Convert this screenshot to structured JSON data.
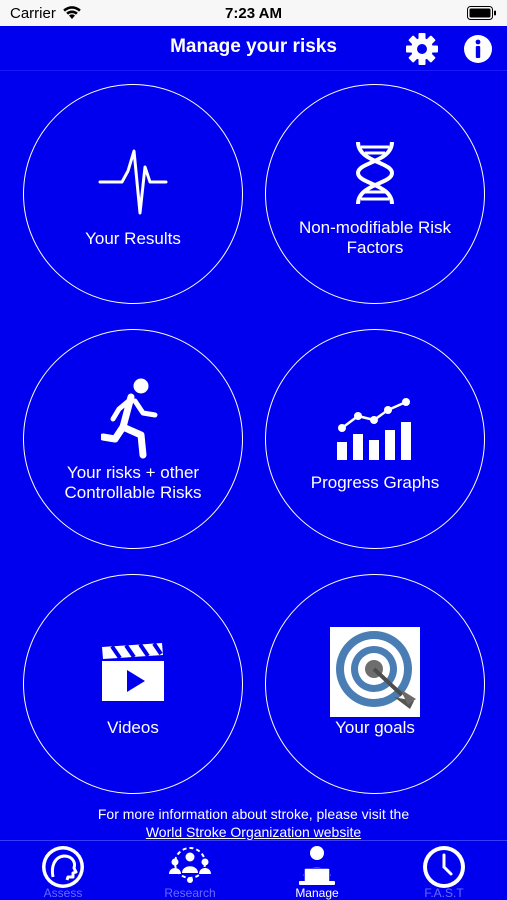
{
  "status_bar": {
    "carrier": "Carrier",
    "time": "7:23 AM"
  },
  "nav": {
    "title": "Manage your risks",
    "settings_icon": "gear-icon",
    "info_icon": "info-icon"
  },
  "tiles": [
    {
      "label": "Your Results",
      "icon": "heartbeat-icon"
    },
    {
      "label": "Non-modifiable Risk Factors",
      "icon": "dna-icon"
    },
    {
      "label": "Your risks + other Controllable Risks",
      "icon": "running-person-icon"
    },
    {
      "label": "Progress Graphs",
      "icon": "bar-chart-icon"
    },
    {
      "label": "Videos",
      "icon": "video-clapper-icon"
    },
    {
      "label": "Your goals",
      "icon": "target-dart-icon"
    }
  ],
  "footer": {
    "text": "For more information about stroke, please visit the",
    "link_text": "World Stroke Organization website"
  },
  "tab_bar": {
    "active_index": 2,
    "tabs": [
      {
        "label": "Assess",
        "icon": "head-icon"
      },
      {
        "label": "Research",
        "icon": "people-icon"
      },
      {
        "label": "Manage",
        "icon": "person-laptop-icon"
      },
      {
        "label": "F.A.S.T",
        "icon": "clock-icon"
      }
    ]
  },
  "colors": {
    "background": "#0000EE",
    "status_bar": "#F7F7F7",
    "inactive_tab": "#6A6AFF"
  }
}
